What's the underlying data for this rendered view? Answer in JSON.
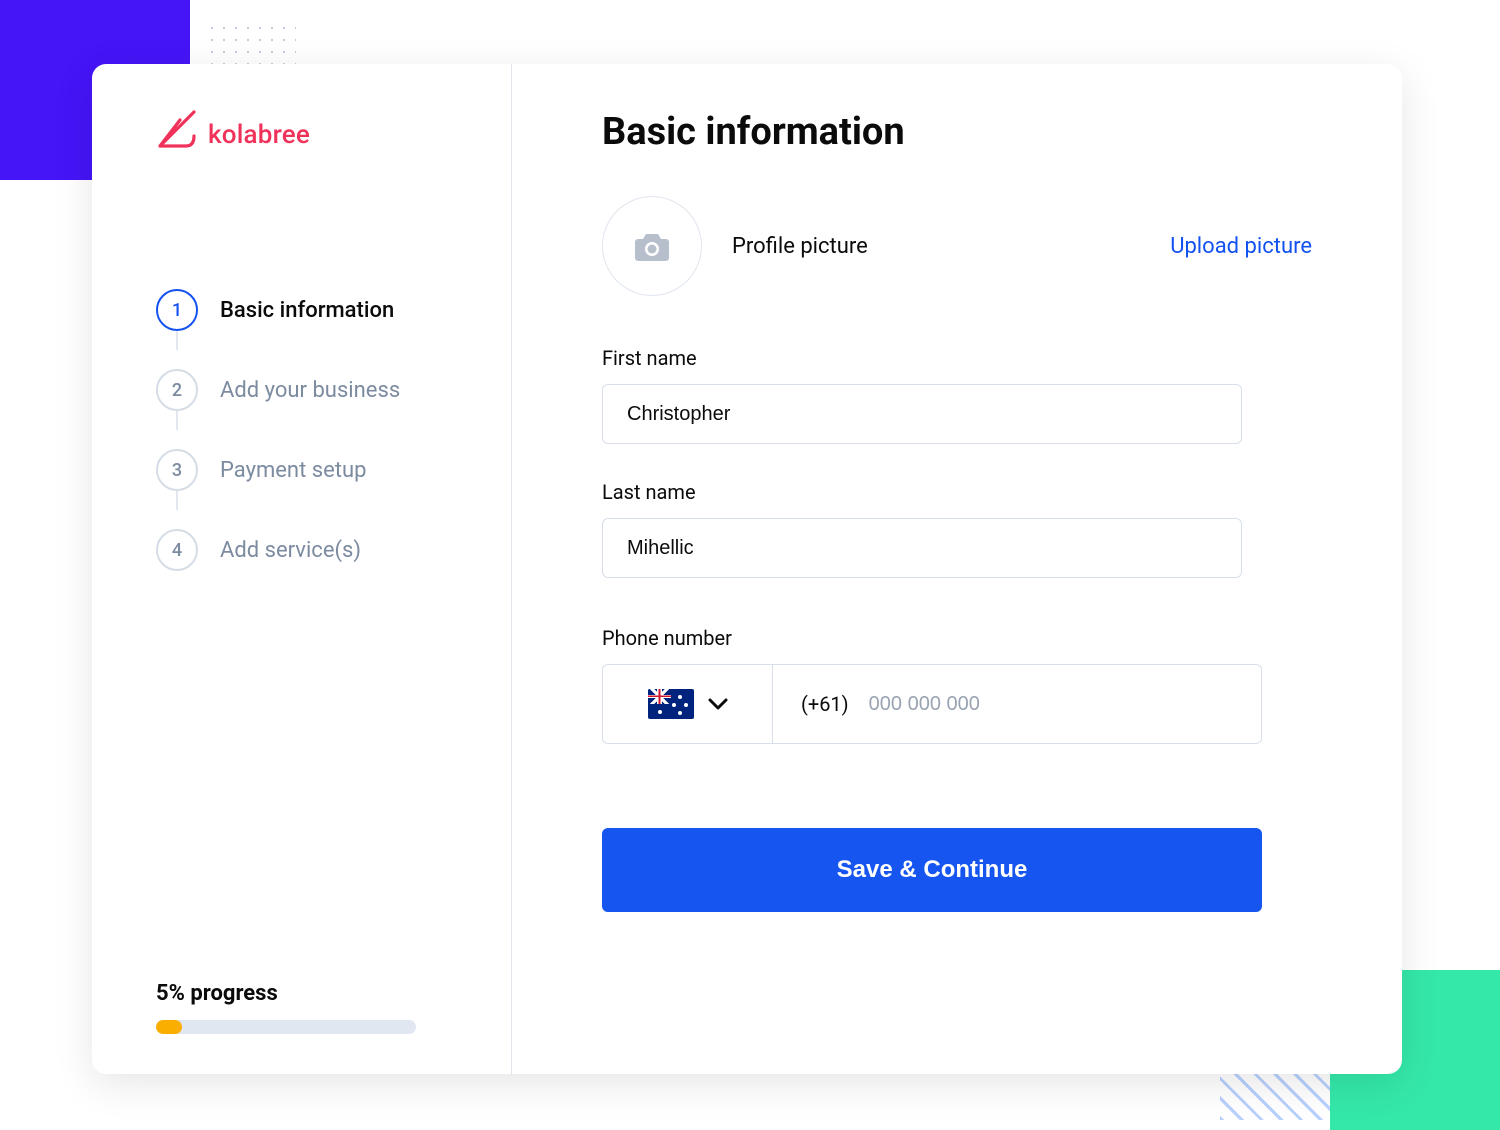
{
  "brand": {
    "name": "kolabree"
  },
  "sidebar": {
    "steps": [
      {
        "num": "1",
        "label": "Basic information",
        "active": true
      },
      {
        "num": "2",
        "label": "Add your business",
        "active": false
      },
      {
        "num": "3",
        "label": "Payment setup",
        "active": false
      },
      {
        "num": "4",
        "label": "Add service(s)",
        "active": false
      }
    ],
    "progress_label": "5% progress",
    "progress_percent": 5
  },
  "main": {
    "title": "Basic information",
    "profile": {
      "label": "Profile picture",
      "upload_link": "Upload picture"
    },
    "fields": {
      "first_name": {
        "label": "First name",
        "value": "Christopher"
      },
      "last_name": {
        "label": "Last name",
        "value": "Mihellic"
      },
      "phone": {
        "label": "Phone number",
        "dial_code": "(+61)",
        "placeholder": "000 000 000",
        "value": ""
      }
    },
    "save_label": "Save & Continue"
  },
  "colors": {
    "accent_purple": "#4514F7",
    "accent_teal": "#34E8A9",
    "brand_red": "#F0325B",
    "primary_blue": "#1655F0",
    "progress_amber": "#F9AE00"
  }
}
